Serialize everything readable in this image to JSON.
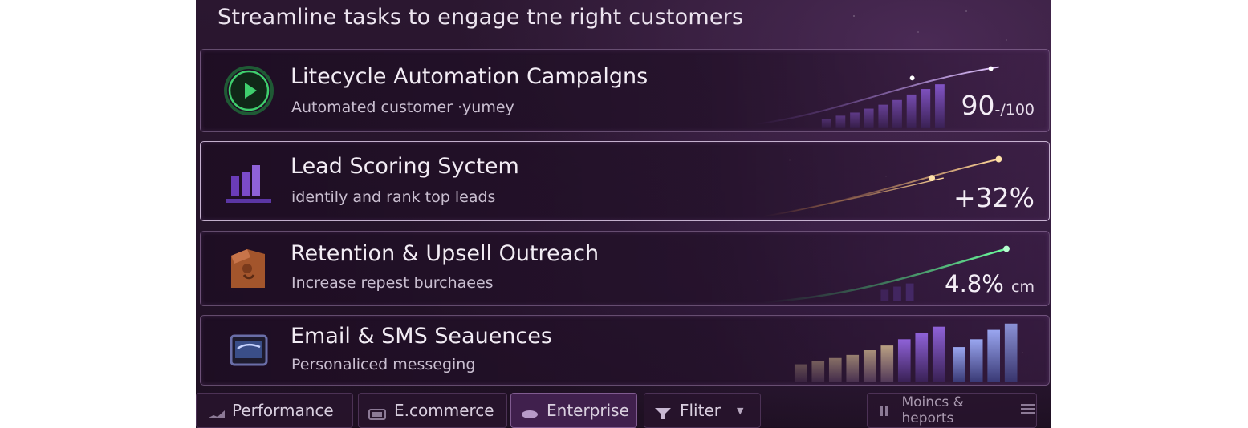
{
  "headline": "Streamline tasks to engage tne right customers",
  "cards": [
    {
      "title": "Litecycle Automation Campalgns",
      "subtitle": "Automated customer ·yumey",
      "metric_value": "90",
      "metric_suffix": "-/100",
      "icon": "play-circle-icon",
      "accent": "#3fcf6e"
    },
    {
      "title": "Lead Scoring Syctem",
      "subtitle": "identily and rank top leads",
      "metric_value": "+32%",
      "metric_suffix": "",
      "icon": "bar-chart-icon",
      "accent": "#e8a24a"
    },
    {
      "title": "Retention & Upsell Outreach",
      "subtitle": "Increase repest burchaees",
      "metric_value": "4.8%",
      "metric_suffix": "cm",
      "icon": "tag-icon",
      "accent": "#37d66c"
    },
    {
      "title": "Email & SMS Seauences",
      "subtitle": "Personaliced messeging",
      "metric_value": "",
      "metric_suffix": "",
      "icon": "monitor-icon",
      "accent": "#9b6fe0"
    }
  ],
  "tabs": [
    {
      "label": "Performance",
      "icon": "trend-icon"
    },
    {
      "label": "E.commerce",
      "icon": "card-icon"
    },
    {
      "label": "Enterprise",
      "icon": "pill-icon"
    },
    {
      "label": "Fliter",
      "icon": "filter-icon"
    },
    {
      "label": "Moincs & heports",
      "icon": "list-icon"
    }
  ],
  "colors": {
    "background": "#241329",
    "text": "#f2ecf4",
    "muted_text": "#c9bed0",
    "bar_purple": "#7b4bc9"
  }
}
